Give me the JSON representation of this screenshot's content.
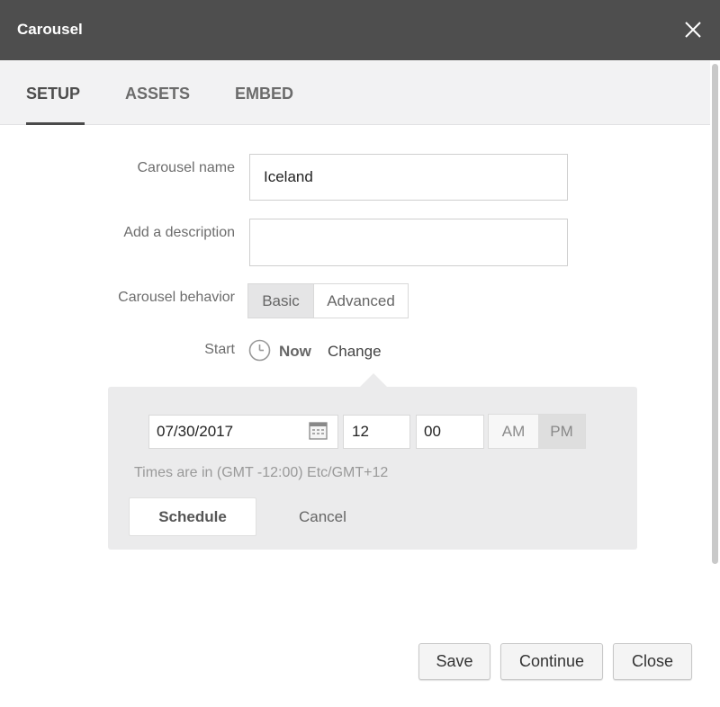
{
  "dialog": {
    "title": "Carousel",
    "close_icon": "close-icon"
  },
  "tabs": [
    {
      "label": "SETUP",
      "active": true
    },
    {
      "label": "ASSETS",
      "active": false
    },
    {
      "label": "EMBED",
      "active": false
    }
  ],
  "form": {
    "name_label": "Carousel name",
    "name_value": "Iceland",
    "description_label": "Add a description",
    "description_value": "",
    "behavior_label": "Carousel behavior",
    "behavior_options": [
      "Basic",
      "Advanced"
    ],
    "behavior_selected": "Basic",
    "start_label": "Start",
    "start_value": "Now",
    "start_change": "Change"
  },
  "schedule": {
    "date": "07/30/2017",
    "hour": "12",
    "minute": "00",
    "am_label": "AM",
    "pm_label": "PM",
    "meridiem_selected": "PM",
    "timezone_note": "Times are in (GMT -12:00) Etc/GMT+12",
    "schedule_label": "Schedule",
    "cancel_label": "Cancel"
  },
  "footer": {
    "save_label": "Save",
    "continue_label": "Continue",
    "close_label": "Close"
  },
  "colors": {
    "titlebar": "#4e4e4e",
    "tabs_bg": "#f2f2f3",
    "panel_bg": "#ebebec"
  }
}
